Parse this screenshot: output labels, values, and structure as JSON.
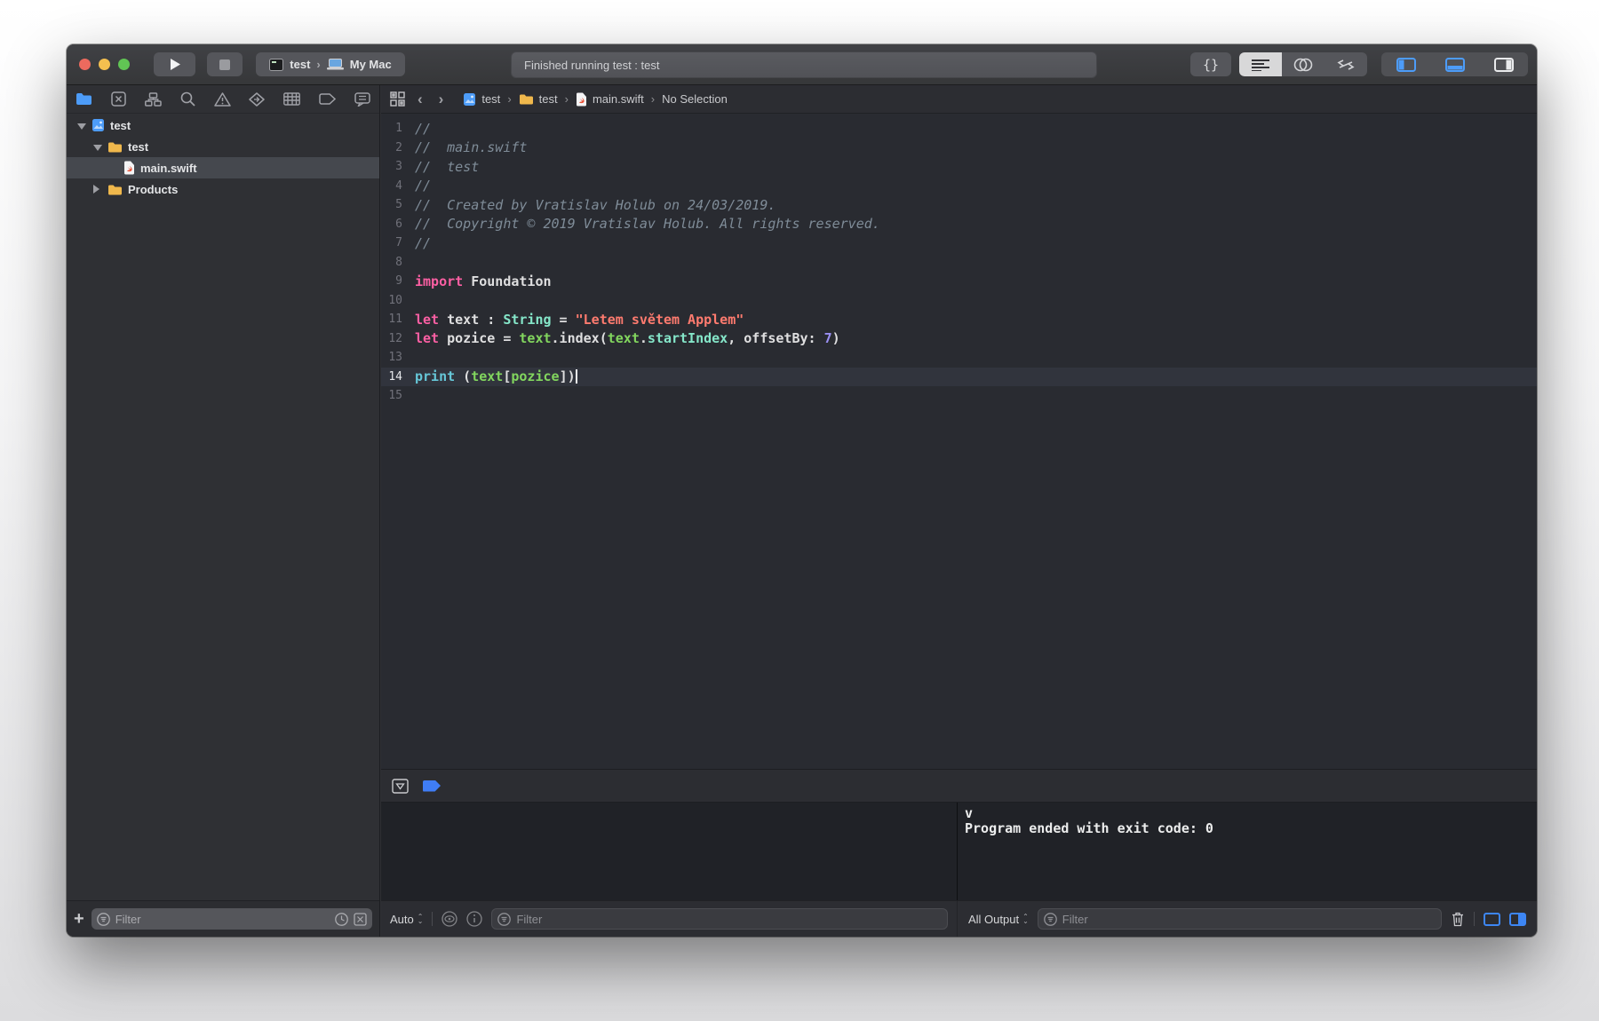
{
  "colors": {
    "accent_blue": "#4d9cf8",
    "keyword_pink": "#fc5fa3",
    "string_red": "#ff7b6f",
    "type_mint": "#85e6c9",
    "func_cyan": "#66c7d8",
    "var_green": "#82d65e",
    "number_purple": "#9a8ff2",
    "comment_gray": "#7f8c98",
    "traffic_red": "#ec6a5e",
    "traffic_yellow": "#f4bf4f",
    "traffic_green": "#61c554",
    "editor_bg": "#292b31",
    "console_bg": "#202227"
  },
  "toolbar": {
    "scheme_target": "test",
    "scheme_destination": "My Mac",
    "status_text": "Finished running test : test",
    "library_button": "{}"
  },
  "navigator": {
    "tree": [
      {
        "label": "test",
        "depth": 0,
        "disclosure": "open",
        "icon": "project",
        "selected": false
      },
      {
        "label": "test",
        "depth": 1,
        "disclosure": "open",
        "icon": "folder",
        "selected": false
      },
      {
        "label": "main.swift",
        "depth": 2,
        "disclosure": "none",
        "icon": "swift",
        "selected": true
      },
      {
        "label": "Products",
        "depth": 1,
        "disclosure": "closed",
        "icon": "folder",
        "selected": false
      }
    ],
    "filter_placeholder": "Filter"
  },
  "jumpbar": {
    "crumbs": [
      {
        "icon": "project",
        "label": "test"
      },
      {
        "icon": "folder",
        "label": "test"
      },
      {
        "icon": "swift",
        "label": "main.swift"
      },
      {
        "icon": "none",
        "label": "No Selection"
      }
    ]
  },
  "editor": {
    "lines": [
      {
        "n": 1,
        "tokens": [
          [
            "cm",
            "//"
          ]
        ]
      },
      {
        "n": 2,
        "tokens": [
          [
            "cm",
            "//  main.swift"
          ]
        ]
      },
      {
        "n": 3,
        "tokens": [
          [
            "cm",
            "//  test"
          ]
        ]
      },
      {
        "n": 4,
        "tokens": [
          [
            "cm",
            "//"
          ]
        ]
      },
      {
        "n": 5,
        "tokens": [
          [
            "cm",
            "//  Created by Vratislav Holub on 24/03/2019."
          ]
        ]
      },
      {
        "n": 6,
        "tokens": [
          [
            "cm",
            "//  Copyright © 2019 Vratislav Holub. All rights reserved."
          ]
        ]
      },
      {
        "n": 7,
        "tokens": [
          [
            "cm",
            "//"
          ]
        ]
      },
      {
        "n": 8,
        "tokens": []
      },
      {
        "n": 9,
        "tokens": [
          [
            "kw",
            "import"
          ],
          [
            "pl",
            " Foundation"
          ]
        ]
      },
      {
        "n": 10,
        "tokens": []
      },
      {
        "n": 11,
        "tokens": [
          [
            "kw",
            "let"
          ],
          [
            "pl",
            " text : "
          ],
          [
            "typ",
            "String"
          ],
          [
            "pl",
            " = "
          ],
          [
            "str",
            "\"Letem světem Applem\""
          ]
        ]
      },
      {
        "n": 12,
        "tokens": [
          [
            "kw",
            "let"
          ],
          [
            "pl",
            " pozice = "
          ],
          [
            "vr",
            "text"
          ],
          [
            "pl",
            ".index("
          ],
          [
            "vr",
            "text"
          ],
          [
            "pl",
            "."
          ],
          [
            "typ",
            "startIndex"
          ],
          [
            "pl",
            ", offsetBy: "
          ],
          [
            "num",
            "7"
          ],
          [
            "pl",
            ")"
          ]
        ]
      },
      {
        "n": 13,
        "tokens": []
      },
      {
        "n": 14,
        "current": true,
        "caret": true,
        "tokens": [
          [
            "fn",
            "print"
          ],
          [
            "pl",
            " ("
          ],
          [
            "vr",
            "text"
          ],
          [
            "pl",
            "["
          ],
          [
            "vr",
            "pozice"
          ],
          [
            "pl",
            "])"
          ]
        ]
      },
      {
        "n": 15,
        "tokens": []
      }
    ]
  },
  "debug": {
    "variables_scope": "Auto",
    "variables_filter_placeholder": "Filter",
    "console_output_mode": "All Output",
    "console_filter_placeholder": "Filter",
    "console_lines": [
      "v",
      "Program ended with exit code: 0"
    ]
  }
}
